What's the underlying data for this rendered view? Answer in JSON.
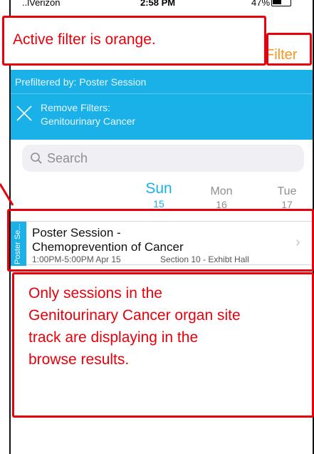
{
  "status": {
    "carrier": "..lVerizon",
    "time": "2:58 PM",
    "battery": "47%"
  },
  "nav": {
    "filter_label": "Filter"
  },
  "prefilter": {
    "label": "Prefiltered by: Poster Session",
    "remove_title": "Remove Filters:",
    "remove_value": "Genitourinary Cancer"
  },
  "search": {
    "placeholder": "Search"
  },
  "days": [
    {
      "name": "Sun",
      "num": "15",
      "active": true
    },
    {
      "name": "Mon",
      "num": "16",
      "active": false
    },
    {
      "name": "Tue",
      "num": "17",
      "active": false
    }
  ],
  "session": {
    "track": "Poster Se...",
    "title_line1": "Poster Session -",
    "title_line2": "Chemoprevention of Cancer",
    "time": "1:00PM-5:00PM  Apr 15",
    "location": "Section 10 - Exhibt Hall"
  },
  "annotations": {
    "filter_note": "Active filter is orange.",
    "results_note_lines": [
      "Only sessions in the",
      "Genitourinary Cancer organ site",
      "track are displaying in the",
      "browse results."
    ]
  },
  "colors": {
    "accent_blue": "#1ab0e8",
    "filter_orange": "#f7941d",
    "annotation_red": "#e8000b"
  }
}
